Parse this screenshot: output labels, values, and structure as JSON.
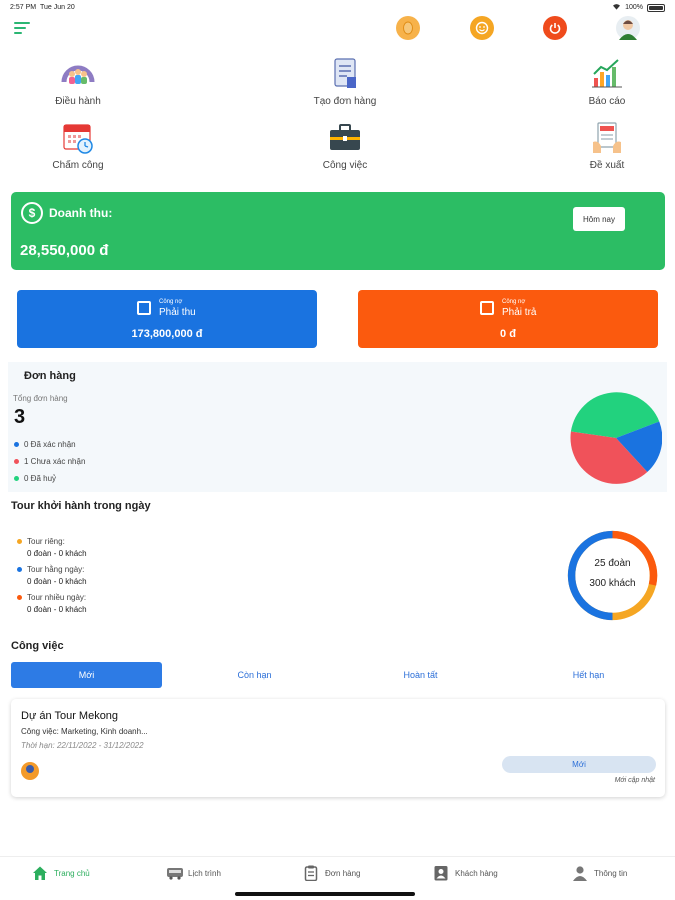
{
  "status_bar": {
    "time": "2:57 PM",
    "date": "Tue Jun 20",
    "battery": "100%"
  },
  "quick_menu": [
    {
      "label": "Điều hành",
      "icon": "team-icon"
    },
    {
      "label": "Tạo đơn hàng",
      "icon": "create-order-icon"
    },
    {
      "label": "Báo cáo",
      "icon": "report-chart-icon"
    },
    {
      "label": "Chấm công",
      "icon": "calendar-clock-icon"
    },
    {
      "label": "Công việc",
      "icon": "briefcase-icon"
    },
    {
      "label": "Đề xuất",
      "icon": "proposal-icon"
    }
  ],
  "revenue": {
    "label": "Doanh thu:",
    "amount": "28,550,000 đ",
    "period_button": "Hôm nay",
    "color": "#2cbd64"
  },
  "debts": [
    {
      "small": "Công nợ",
      "name": "Phải thu",
      "value": "173,800,000 đ",
      "color": "#1a73e0"
    },
    {
      "small": "Công nợ",
      "name": "Phải trả",
      "value": "0 đ",
      "color": "#fb5a0e"
    }
  ],
  "orders": {
    "title": "Đơn hàng",
    "total_label": "Tổng đơn hàng",
    "total": "3",
    "legend": [
      {
        "label": "0 Đã xác nhận",
        "color": "#1a73e0"
      },
      {
        "label": "1 Chưa xác nhận",
        "color": "#f0525a"
      },
      {
        "label": "0 Đã huỷ",
        "color": "#22d27e"
      }
    ]
  },
  "tours": {
    "title": "Tour khởi hành trong ngày",
    "items": [
      {
        "label": "Tour riêng:",
        "value": "0 đoàn - 0 khách",
        "color": "#f5a623"
      },
      {
        "label": "Tour hằng ngày:",
        "value": "0 đoàn - 0 khách",
        "color": "#1a73e0"
      },
      {
        "label": "Tour nhiều ngày:",
        "value": "0 đoàn - 0 khách",
        "color": "#fb5a0e"
      }
    ],
    "donut_groups": "25 đoàn",
    "donut_guests": "300 khách"
  },
  "work": {
    "title": "Công việc",
    "tabs": [
      "Mới",
      "Còn hạn",
      "Hoàn tất",
      "Hết hạn"
    ],
    "active_tab": 0,
    "card": {
      "title": "Dự án Tour Mekong",
      "job": "Công việc: Marketing, Kinh doanh...",
      "due": "Thời hạn: 22/11/2022 - 31/12/2022",
      "status": "Mới",
      "updated": "Mới cập nhật"
    }
  },
  "bottom_nav": [
    {
      "label": "Trang chủ",
      "icon": "home-icon",
      "active": true
    },
    {
      "label": "Lịch trình",
      "icon": "bus-icon",
      "active": false
    },
    {
      "label": "Đơn hàng",
      "icon": "clipboard-icon",
      "active": false
    },
    {
      "label": "Khách hàng",
      "icon": "customer-card-icon",
      "active": false
    },
    {
      "label": "Thông tin",
      "icon": "user-icon",
      "active": false
    }
  ]
}
